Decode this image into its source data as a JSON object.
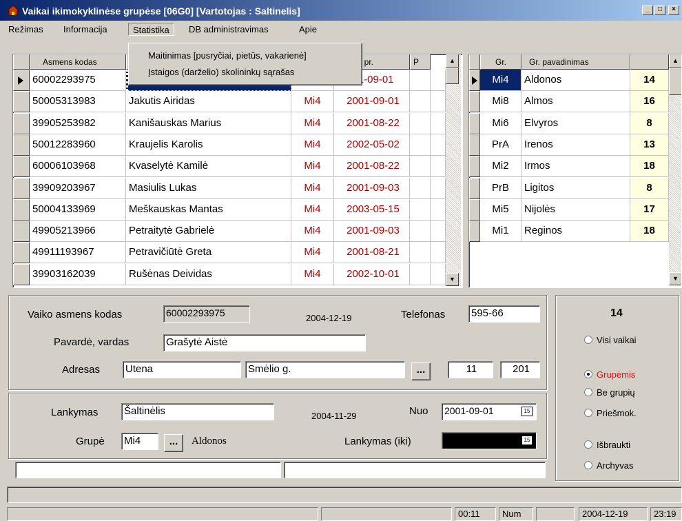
{
  "window": {
    "title": "Vaikai ikimokyklinėse grupėse [06G0] [Vartotojas : Saltinelis]",
    "controls": [
      "_",
      "□",
      "×"
    ]
  },
  "menu": {
    "items": [
      "Režimas",
      "Informacija",
      "Statistika",
      "DB administravimas",
      "Apie"
    ],
    "active": "Statistika",
    "dropdown": [
      "Maitinimas [pusryčiai, pietūs, vakarienė]",
      "Įstaigos (darželio) skolininkų sąrašas"
    ]
  },
  "children_table": {
    "headers": [
      "Asmens kodas",
      "",
      "",
      "nkymo pr.",
      "P"
    ],
    "rows": [
      {
        "code": "60002293975",
        "name": "G",
        "group": "",
        "date": "01-09-01",
        "selected": true
      },
      {
        "code": "50005313983",
        "name": "Jakutis Airidas",
        "group": "Mi4",
        "date": "2001-09-01"
      },
      {
        "code": "39905253982",
        "name": "Kanišauskas Marius",
        "group": "Mi4",
        "date": "2001-08-22"
      },
      {
        "code": "50012283960",
        "name": "Kraujelis Karolis",
        "group": "Mi4",
        "date": "2002-05-02"
      },
      {
        "code": "60006103968",
        "name": "Kvaselytė Kamilė",
        "group": "Mi4",
        "date": "2001-08-22"
      },
      {
        "code": "39909203967",
        "name": "Masiulis Lukas",
        "group": "Mi4",
        "date": "2001-09-03"
      },
      {
        "code": "50004133969",
        "name": "Meškauskas Mantas",
        "group": "Mi4",
        "date": "2003-05-15"
      },
      {
        "code": "49905213966",
        "name": "Petraitytė Gabrielė",
        "group": "Mi4",
        "date": "2001-09-03"
      },
      {
        "code": "49911193967",
        "name": "Petravičiūtė Greta",
        "group": "Mi4",
        "date": "2001-08-21"
      },
      {
        "code": "39903162039",
        "name": "Rušėnas Deividas",
        "group": "Mi4",
        "date": "2002-10-01"
      }
    ]
  },
  "groups_table": {
    "headers": [
      "Gr.",
      "Gr. pavadinimas",
      ""
    ],
    "rows": [
      {
        "code": "Mi4",
        "name": "Aldonos",
        "count": "14",
        "selected": true
      },
      {
        "code": "Mi8",
        "name": "Almos",
        "count": "16"
      },
      {
        "code": "Mi6",
        "name": "Elvyros",
        "count": "8"
      },
      {
        "code": "PrA",
        "name": "Irenos",
        "count": "13"
      },
      {
        "code": "Mi2",
        "name": "Irmos",
        "count": "18"
      },
      {
        "code": "PrB",
        "name": "Ligitos",
        "count": "8"
      },
      {
        "code": "Mi5",
        "name": "Nijolės",
        "count": "17"
      },
      {
        "code": "Mi1",
        "name": "Reginos",
        "count": "18"
      }
    ]
  },
  "form": {
    "code_label": "Vaiko asmens kodas",
    "code_value": "60002293975",
    "date1": "2004-12-19",
    "phone_label": "Telefonas",
    "phone_value": "595-66",
    "name_label": "Pavardė, vardas",
    "name_value": "Grašytė Aistė",
    "address_label": "Adresas",
    "city": "Utena",
    "street": "Smėlio g.",
    "dots": "...",
    "house": "11",
    "flat": "201",
    "attend_label": "Lankymas",
    "attend_value": "Šaltinėlis",
    "date2": "2004-11-29",
    "from_label": "Nuo",
    "from_value": "2001-09-01",
    "group_label": "Grupė",
    "group_value": "Mi4",
    "group_name": "Aldonos",
    "until_label": "Lankymas (iki)",
    "cal_icon": "15"
  },
  "filter": {
    "count": "14",
    "options": [
      {
        "label": "Visi vaikai",
        "checked": false
      },
      {
        "label": "Grupėmis",
        "checked": true,
        "color": "#ff0000"
      },
      {
        "label": "Be grupių",
        "checked": false
      },
      {
        "label": "Priešmok.",
        "checked": false
      },
      {
        "label": "Išbraukti",
        "checked": false
      },
      {
        "label": "Archyvas",
        "checked": false
      }
    ]
  },
  "status": {
    "time_elapsed": "00:11",
    "num": "Num",
    "date": "2004-12-19",
    "clock": "23:19"
  }
}
